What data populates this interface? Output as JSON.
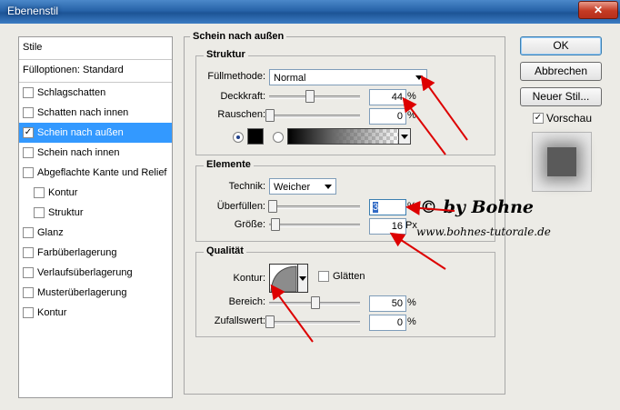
{
  "window": {
    "title": "Ebenenstil",
    "close_symbol": "✕"
  },
  "styles_list": {
    "header": "Stile",
    "blend_options": "Fülloptionen: Standard",
    "items": [
      {
        "label": "Schlagschatten",
        "checked": false,
        "selected": false,
        "indent": false
      },
      {
        "label": "Schatten nach innen",
        "checked": false,
        "selected": false,
        "indent": false
      },
      {
        "label": "Schein nach außen",
        "checked": true,
        "selected": true,
        "indent": false
      },
      {
        "label": "Schein nach innen",
        "checked": false,
        "selected": false,
        "indent": false
      },
      {
        "label": "Abgeflachte Kante und Relief",
        "checked": false,
        "selected": false,
        "indent": false
      },
      {
        "label": "Kontur",
        "checked": false,
        "selected": false,
        "indent": true
      },
      {
        "label": "Struktur",
        "checked": false,
        "selected": false,
        "indent": true
      },
      {
        "label": "Glanz",
        "checked": false,
        "selected": false,
        "indent": false
      },
      {
        "label": "Farbüberlagerung",
        "checked": false,
        "selected": false,
        "indent": false
      },
      {
        "label": "Verlaufsüberlagerung",
        "checked": false,
        "selected": false,
        "indent": false
      },
      {
        "label": "Musterüberlagerung",
        "checked": false,
        "selected": false,
        "indent": false
      },
      {
        "label": "Kontur",
        "checked": false,
        "selected": false,
        "indent": false
      }
    ]
  },
  "panel": {
    "title": "Schein nach außen",
    "structure": {
      "title": "Struktur",
      "blend_mode_label": "Füllmethode:",
      "blend_mode_value": "Normal",
      "opacity_label": "Deckkraft:",
      "opacity_value": "44",
      "opacity_unit": "%",
      "opacity_level": 0.44,
      "noise_label": "Rauschen:",
      "noise_value": "0",
      "noise_unit": "%",
      "noise_level": 0.0,
      "color_mode": "color",
      "glow_color": "#000000"
    },
    "elements": {
      "title": "Elemente",
      "technique_label": "Technik:",
      "technique_value": "Weicher",
      "spread_label": "Überfüllen:",
      "spread_value": "3",
      "spread_unit": "%",
      "spread_level": 0.03,
      "size_label": "Größe:",
      "size_value": "16",
      "size_unit": "Px",
      "size_level": 0.064
    },
    "quality": {
      "title": "Qualität",
      "contour_label": "Kontur:",
      "antialias_label": "Glätten",
      "antialias_checked": false,
      "range_label": "Bereich:",
      "range_value": "50",
      "range_unit": "%",
      "range_level": 0.5,
      "jitter_label": "Zufallswert:",
      "jitter_value": "0",
      "jitter_unit": "%",
      "jitter_level": 0.0
    }
  },
  "buttons": {
    "ok": "OK",
    "cancel": "Abbrechen",
    "new_style": "Neuer Stil...",
    "preview_label": "Vorschau",
    "preview_checked": true
  },
  "watermark": {
    "line1": "© by Bohne",
    "line2": "www.bohnes-tutorale.de"
  },
  "colors": {
    "accent": "#3399ff",
    "annotation": "#dd0000",
    "titlebar": "#2763a8"
  }
}
